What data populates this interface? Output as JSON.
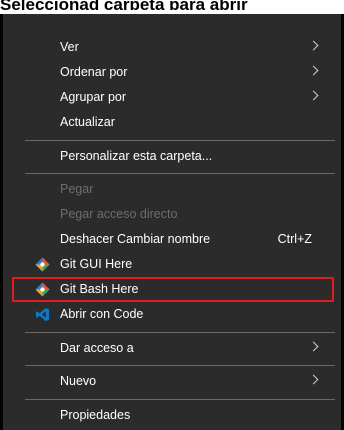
{
  "page": {
    "heading": "Seleccionad carpeta para abrir"
  },
  "menu": {
    "items": [
      {
        "label": "Ver",
        "submenu": true
      },
      {
        "label": "Ordenar por",
        "submenu": true
      },
      {
        "label": "Agrupar por",
        "submenu": true
      },
      {
        "label": "Actualizar"
      },
      {
        "label": "Personalizar esta carpeta..."
      },
      {
        "label": "Pegar",
        "disabled": true
      },
      {
        "label": "Pegar acceso directo",
        "disabled": true
      },
      {
        "label": "Deshacer Cambiar nombre",
        "shortcut": "Ctrl+Z"
      },
      {
        "label": "Git GUI Here",
        "icon": "git-icon"
      },
      {
        "label": "Git Bash Here",
        "icon": "git-icon",
        "highlighted": true
      },
      {
        "label": "Abrir con Code",
        "icon": "vscode-icon"
      },
      {
        "label": "Dar acceso a",
        "submenu": true
      },
      {
        "label": "Nuevo",
        "submenu": true
      },
      {
        "label": "Propiedades"
      }
    ]
  },
  "colors": {
    "menu_background": "#2b2b2b",
    "text": "#ffffff",
    "disabled_text": "#6d6d6d",
    "separator": "#6a6a6a",
    "highlight_border": "#e11d1d",
    "vscode_blue": "#0a7acc"
  }
}
